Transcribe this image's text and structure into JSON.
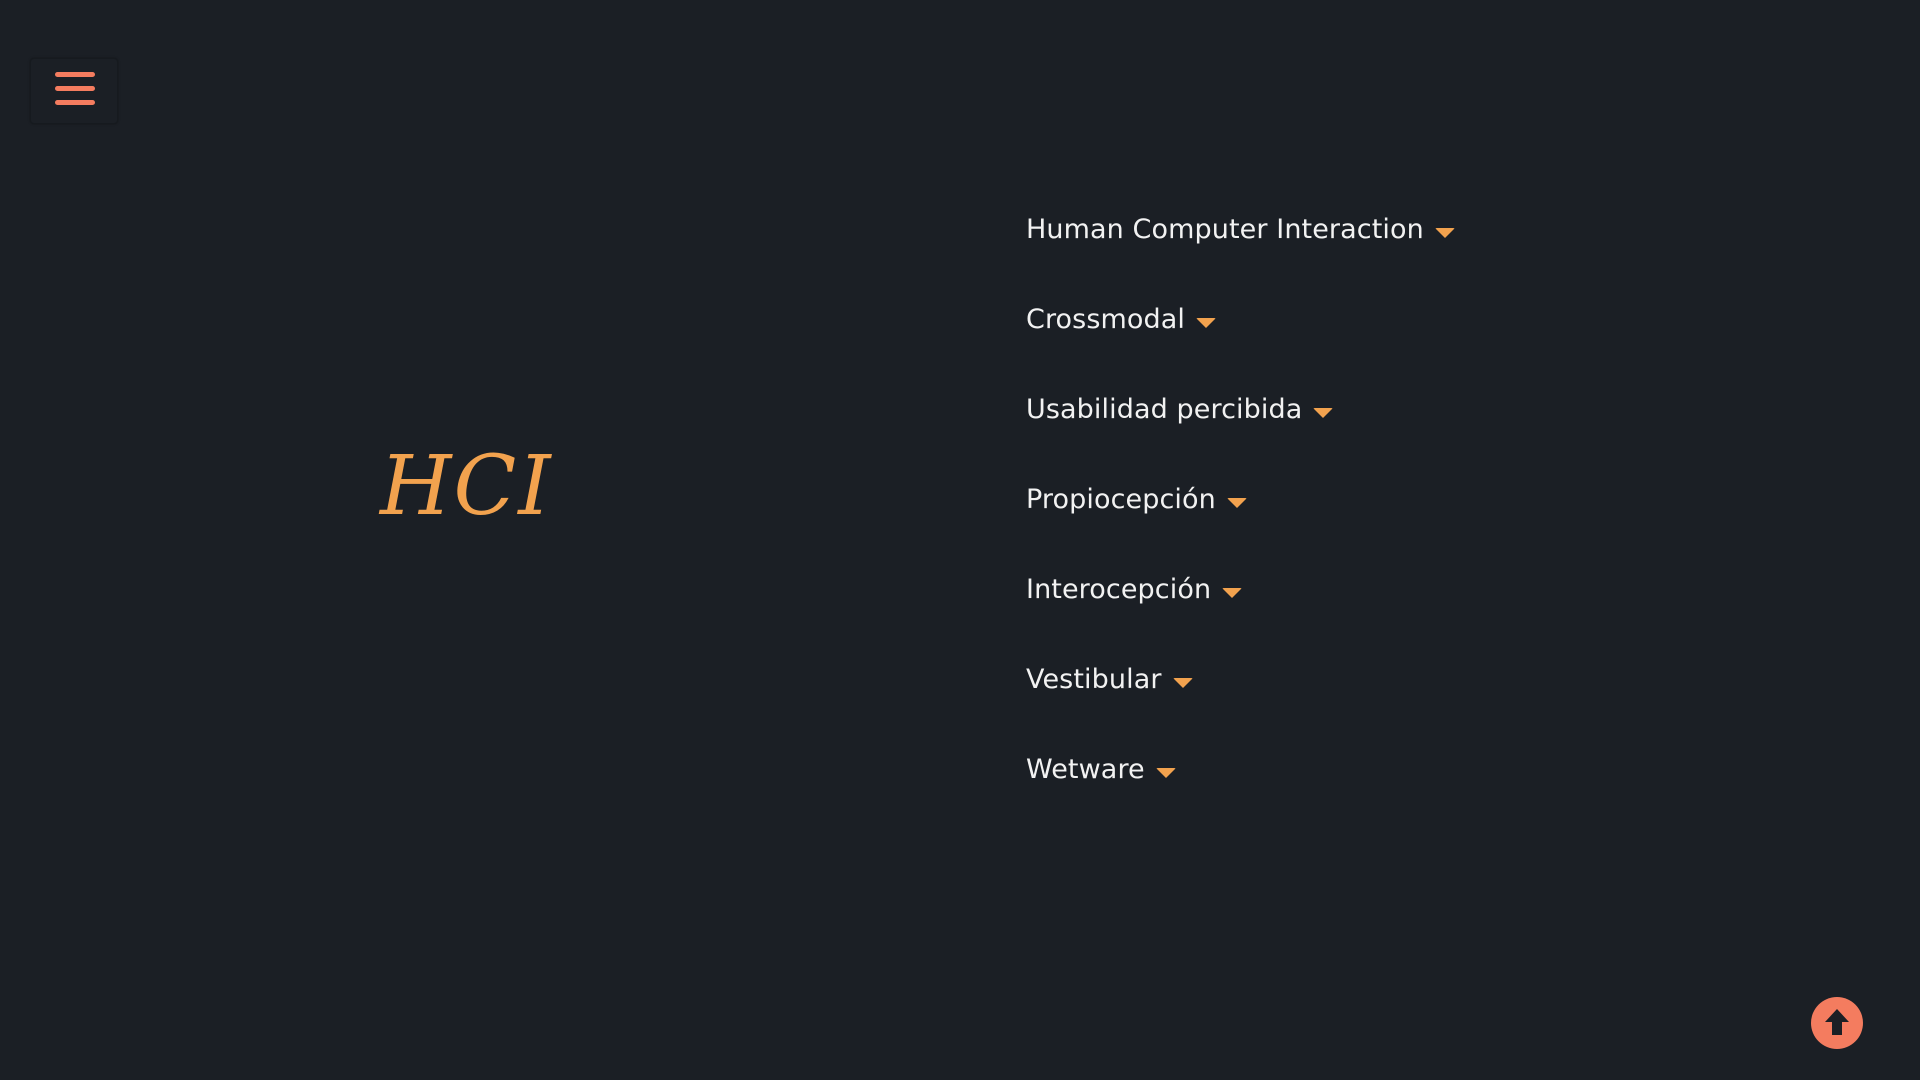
{
  "header": {
    "menu_icon": "hamburger-menu-icon",
    "menu_color": "#f47c5f"
  },
  "hero": {
    "title": "HCI",
    "title_color": "#f2a24e"
  },
  "topics": [
    {
      "label": "Human Computer Interaction",
      "icon": "caret-down-icon"
    },
    {
      "label": "Crossmodal",
      "icon": "caret-down-icon"
    },
    {
      "label": "Usabilidad percibida",
      "icon": "caret-down-icon"
    },
    {
      "label": "Propiocepción",
      "icon": "caret-down-icon"
    },
    {
      "label": "Interocepción",
      "icon": "caret-down-icon"
    },
    {
      "label": "Vestibular",
      "icon": "caret-down-icon"
    },
    {
      "label": "Wetware",
      "icon": "caret-down-icon"
    }
  ],
  "colors": {
    "background": "#1b1f25",
    "text": "#f2f2f2",
    "accent": "#f2a24e",
    "button": "#f47c5f"
  },
  "scroll_top": {
    "icon": "arrow-up-circle-icon"
  }
}
